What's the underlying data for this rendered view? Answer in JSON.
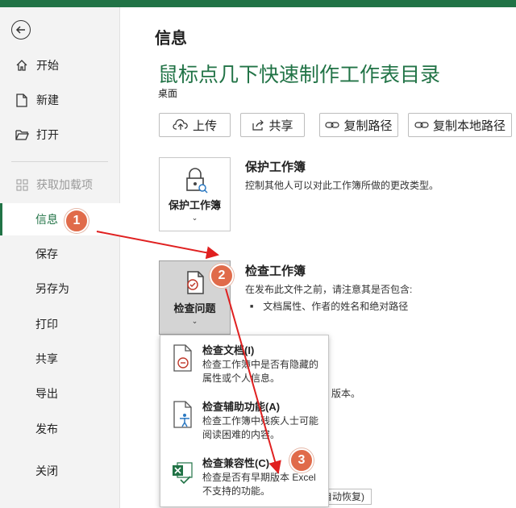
{
  "colors": {
    "brand_green": "#217346",
    "callout": "#e06b4a",
    "arrow": "#e02020"
  },
  "sidebar": {
    "back_icon": "back-arrow-icon",
    "items": [
      {
        "label": "开始",
        "icon": "home-icon"
      },
      {
        "label": "新建",
        "icon": "new-file-icon"
      },
      {
        "label": "打开",
        "icon": "folder-open-icon"
      },
      {
        "label": "获取加载项",
        "icon": "addins-icon"
      },
      {
        "label": "信息"
      },
      {
        "label": "保存"
      },
      {
        "label": "另存为"
      },
      {
        "label": "打印"
      },
      {
        "label": "共享"
      },
      {
        "label": "导出"
      },
      {
        "label": "发布"
      },
      {
        "label": "关闭"
      }
    ]
  },
  "main": {
    "page_title": "信息",
    "doc_title": "鼠标点几下快速制作工作表目录",
    "doc_location": "桌面",
    "actions": [
      {
        "label": "上传",
        "icon": "upload-icon"
      },
      {
        "label": "共享",
        "icon": "share-icon"
      },
      {
        "label": "复制路径",
        "icon": "link-icon"
      },
      {
        "label": "复制本地路径",
        "icon": "link-icon"
      }
    ],
    "protect": {
      "tile_label": "保护工作簿",
      "title": "保护工作簿",
      "desc": "控制其他人可以对此工作簿所做的更改类型。"
    },
    "inspect": {
      "tile_label": "检查问题",
      "title": "检查工作簿",
      "desc": "在发布此文件之前，请注意其是否包含:",
      "bullet": "文档属性、作者的姓名和绝对路径"
    },
    "behind_text_1": "版本。",
    "behind_box_text": "自动恢复)"
  },
  "dropdown": {
    "items": [
      {
        "title": "检查文档(I)",
        "desc": "检查工作簿中是否有隐藏的属性或个人信息。",
        "icon": "inspect-document-icon"
      },
      {
        "title": "检查辅助功能(A)",
        "desc": "检查工作簿中残疾人士可能阅读困难的内容。",
        "icon": "accessibility-icon"
      },
      {
        "title": "检查兼容性(C)",
        "desc": "检查是否有早期版本 Excel 不支持的功能。",
        "icon": "excel-compat-icon"
      }
    ]
  },
  "callouts": [
    "1",
    "2",
    "3"
  ]
}
